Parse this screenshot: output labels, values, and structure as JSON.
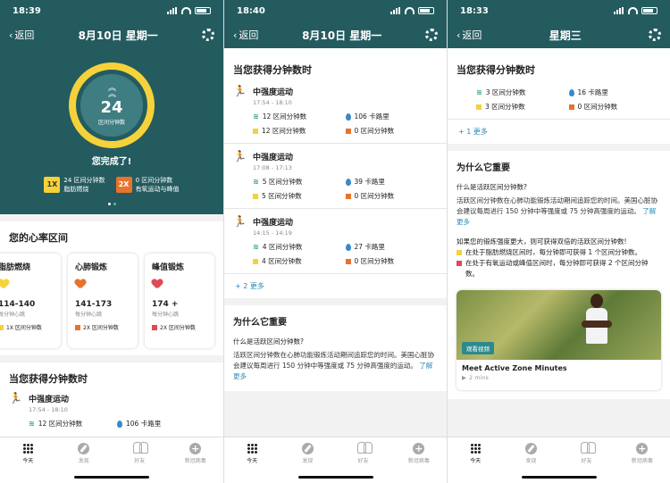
{
  "colors": {
    "teal": "#245b5f",
    "yellow": "#f5d23a",
    "orange": "#e8732c",
    "red": "#e04a55",
    "teal_zone": "#2c9c8e",
    "link": "#2b8bb5"
  },
  "tabs": [
    {
      "label": "今天",
      "icon": "dots-grid-icon"
    },
    {
      "label": "发现",
      "icon": "compass-icon"
    },
    {
      "label": "好友",
      "icon": "friends-icon"
    },
    {
      "label": "新冠病毒",
      "icon": "plus-circle-icon"
    }
  ],
  "panel1": {
    "time": "18:39",
    "back": "返回",
    "title": "8月10日 星期一",
    "ring": {
      "value": "24",
      "unit": "区间分钟数"
    },
    "done": "您完成了!",
    "badges": [
      {
        "mult": "1X",
        "line1": "24 区间分钟数",
        "line2": "脂肪燃烧"
      },
      {
        "mult": "2X",
        "line1": "0 区间分钟数",
        "line2": "有氧运动与峰值"
      }
    ],
    "hr_title": "您的心率区间",
    "hr_cards": [
      {
        "name": "脂肪燃烧",
        "range": "114-140",
        "sub": "每分钟心跳",
        "mult": "1X 区间分钟数"
      },
      {
        "name": "心肺锻炼",
        "range": "141-173",
        "sub": "每分钟心跳",
        "mult": "2X 区间分钟数"
      },
      {
        "name": "峰值锻炼",
        "range": "174 +",
        "sub": "每分钟心跳",
        "mult": "2X 区间分钟数"
      }
    ],
    "earn_title": "当您获得分钟数时",
    "activity": {
      "title": "中强度运动",
      "time": "17:54 - 18:10",
      "zone": "12 区间分钟数",
      "cal": "106 卡路里"
    }
  },
  "panel2": {
    "time": "18:40",
    "back": "返回",
    "title": "8月10日 星期一",
    "earn_title": "当您获得分钟数时",
    "activities": [
      {
        "title": "中强度运动",
        "time": "17:54 - 18:10",
        "zone": "12 区间分钟数",
        "cal": "106 卡路里",
        "fat": "12 区间分钟数",
        "cardio": "0 区间分钟数"
      },
      {
        "title": "中强度运动",
        "time": "17:08 - 17:13",
        "zone": "5 区间分钟数",
        "cal": "39 卡路里",
        "fat": "5 区间分钟数",
        "cardio": "0 区间分钟数"
      },
      {
        "title": "中强度运动",
        "time": "14:15 - 14:19",
        "zone": "4 区间分钟数",
        "cal": "27 卡路里",
        "fat": "4 区间分钟数",
        "cardio": "0 区间分钟数"
      }
    ],
    "more": "+ 2 更多",
    "why_title": "为什么它重要",
    "why_q": "什么是活跃区间分钟数?",
    "why_p": "活跃区间分钟数在心肺功能锻炼活动期间追踪您的时间。美国心脏协会建议每周进行 150 分钟中等强度或 75 分钟高强度的运动。",
    "learn_more": "了解更多"
  },
  "panel3": {
    "time": "18:33",
    "back": "返回",
    "title": "星期三",
    "earn_title": "当您获得分钟数时",
    "activity": {
      "zone": "3 区间分钟数",
      "cal": "16 卡路里",
      "fat": "3 区间分钟数",
      "cardio": "0 区间分钟数"
    },
    "more": "+ 1 更多",
    "why_title": "为什么它重要",
    "why_q": "什么是活跃区间分钟数?",
    "why_p": "活跃区间分钟数在心肺功能锻炼活动期间追踪您的时间。美国心脏协会建议每周进行 150 分钟中等强度或 75 分钟高强度的运动。",
    "learn_more": "了解更多",
    "list_intro": "如果您的锻炼强度更大，则可获得双倍的活跃区间分钟数!",
    "list": [
      "在处于脂肪燃烧区间时，每分钟即可获得 1 个区间分钟数。",
      "在处于有氧运动或峰值区间时，每分钟即可获得 2 个区间分钟数。"
    ],
    "video": {
      "tag": "观看视频",
      "title": "Meet Active Zone Minutes",
      "duration": "2 mins"
    }
  }
}
